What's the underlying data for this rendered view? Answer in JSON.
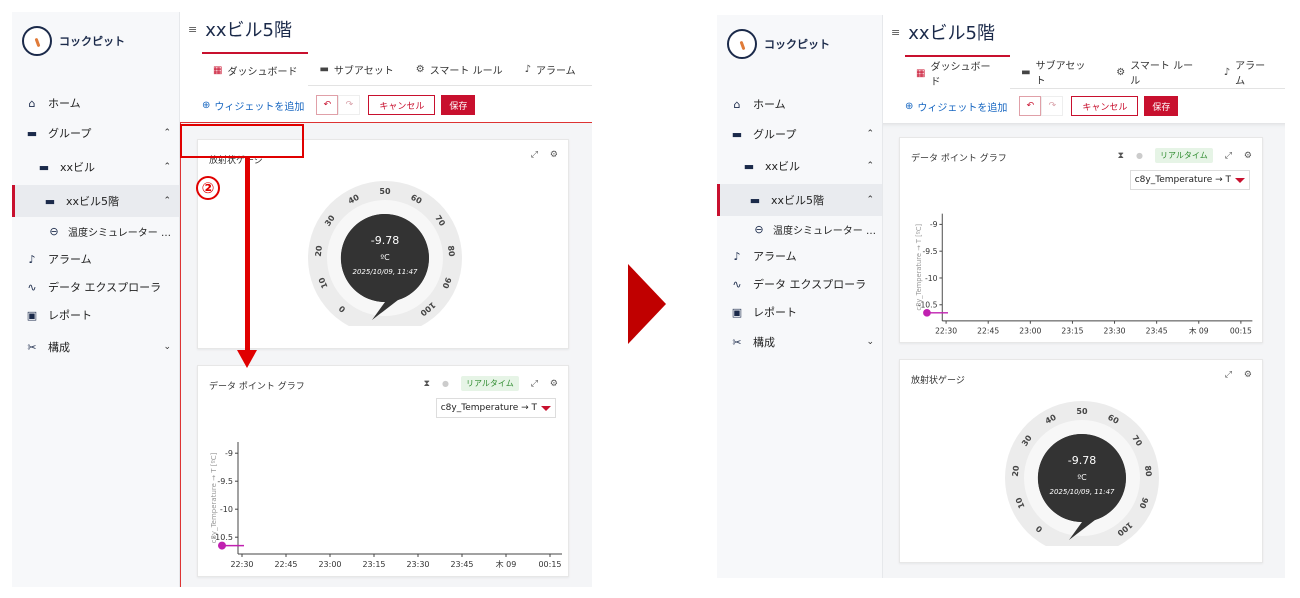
{
  "app": {
    "name": "コックピット",
    "page_title": "xxビル5階"
  },
  "sidebar": {
    "items": [
      {
        "label": "ホーム",
        "icon": "home-icon"
      },
      {
        "label": "グループ",
        "icon": "folder-icon"
      },
      {
        "label": "xxビル",
        "icon": "folder-icon"
      },
      {
        "label": "xxビル5階",
        "icon": "folder-icon"
      },
      {
        "label": "温度シミュレーター …",
        "icon": "device-icon"
      },
      {
        "label": "アラーム",
        "icon": "bell-icon"
      },
      {
        "label": "データ エクスプローラ",
        "icon": "data-explorer-icon"
      },
      {
        "label": "レポート",
        "icon": "report-icon"
      },
      {
        "label": "構成",
        "icon": "config-icon"
      }
    ]
  },
  "tabs": [
    "ダッシュボード",
    "サブアセット",
    "スマート ルール",
    "アラーム"
  ],
  "toolbar": {
    "add_widget": "ウィジェットを追加",
    "cancel": "キャンセル",
    "save": "保存"
  },
  "widgets": {
    "gauge": {
      "title": "放射状ゲージ",
      "value": "-9.78",
      "unit": "ºC",
      "timestamp": "2025/10/09, 11:47",
      "scale": [
        "0",
        "10",
        "20",
        "30",
        "40",
        "50",
        "60",
        "70",
        "80",
        "90",
        "100"
      ],
      "range": [
        0,
        100
      ]
    },
    "graph": {
      "title": "データ ポイント グラフ",
      "realtime": "リアルタイム",
      "datapoint": "c8y_Temperature → T",
      "axis_label": "c8y_Temperature → T [ºC]"
    }
  },
  "annotation": {
    "step": "②"
  },
  "colors": {
    "accent": "#c8102e",
    "navy": "#1b2a4a",
    "series": "#c020b0",
    "annotation": "#e00000"
  },
  "chart_data": {
    "type": "line",
    "title": "データ ポイント グラフ",
    "xlabel": "",
    "ylabel": "c8y_Temperature → T [ºC]",
    "x_ticks": [
      "22:30",
      "22:45",
      "23:00",
      "23:15",
      "23:30",
      "23:45",
      "木 09",
      "00:15"
    ],
    "y_ticks": [
      "-9",
      "-9.5",
      "-10",
      "-10.5"
    ],
    "ylim": [
      -10.8,
      -8.8
    ],
    "series": [
      {
        "name": "c8y_Temperature → T",
        "points": [
          {
            "x": "22:30",
            "y": -10.65
          }
        ]
      }
    ]
  }
}
